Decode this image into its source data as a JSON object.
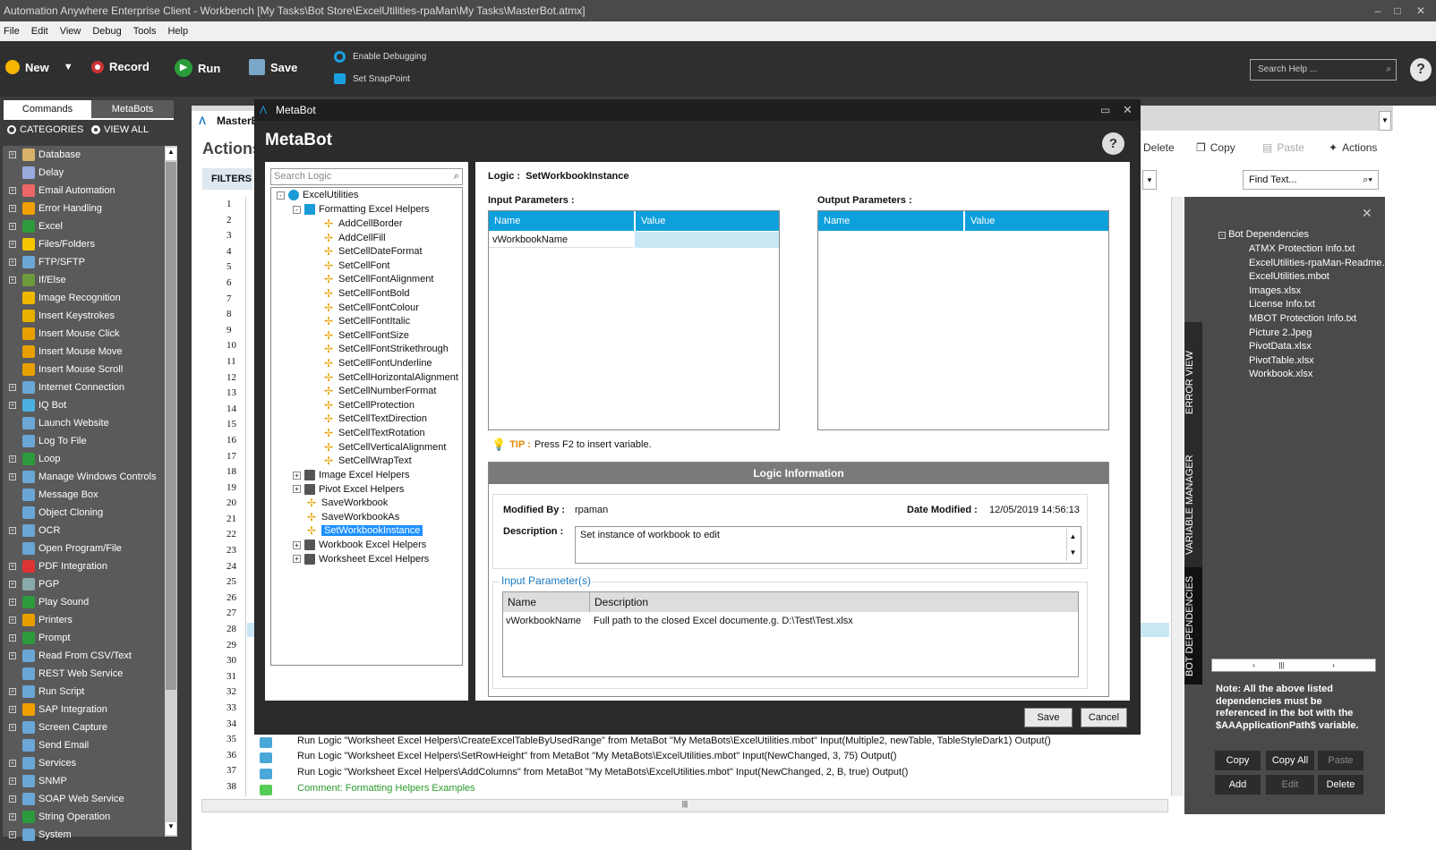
{
  "window": {
    "title": "Automation Anywhere Enterprise Client - Workbench [My Tasks\\Bot Store\\ExcelUtilities-rpaMan\\My Tasks\\MasterBot.atmx]"
  },
  "menu": [
    "File",
    "Edit",
    "View",
    "Debug",
    "Tools",
    "Help"
  ],
  "toolbar": {
    "new": "New",
    "record": "Record",
    "run": "Run",
    "save": "Save",
    "enable_debugging": "Enable Debugging",
    "set_snappoint": "Set SnapPoint",
    "search_help": "Search Help ..."
  },
  "left": {
    "tab_commands": "Commands",
    "tab_metabots": "MetaBots",
    "radio_categories": "CATEGORIES",
    "radio_viewall": "VIEW ALL",
    "commands": [
      "Database",
      "Delay",
      "Email Automation",
      "Error Handling",
      "Excel",
      "Files/Folders",
      "FTP/SFTP",
      "If/Else",
      "Image Recognition",
      "Insert Keystrokes",
      "Insert Mouse Click",
      "Insert Mouse Move",
      "Insert Mouse Scroll",
      "Internet Connection",
      "IQ Bot",
      "Launch Website",
      "Log To File",
      "Loop",
      "Manage Windows Controls",
      "Message Box",
      "Object Cloning",
      "OCR",
      "Open Program/File",
      "PDF Integration",
      "PGP",
      "Play Sound",
      "Printers",
      "Prompt",
      "Read From CSV/Text",
      "REST Web Service",
      "Run Script",
      "SAP Integration",
      "Screen Capture",
      "Send Email",
      "Services",
      "SNMP",
      "SOAP Web Service",
      "String Operation",
      "System"
    ]
  },
  "workbench": {
    "tab": "MasterBot",
    "actions_label": "Actions",
    "filters_label": "FILTERS",
    "tools": {
      "delete": "Delete",
      "copy": "Copy",
      "paste": "Paste",
      "actions": "Actions"
    },
    "find_text": "Find Text...",
    "line_numbers": [
      "1",
      "2",
      "3",
      "4",
      "5",
      "6",
      "7",
      "8",
      "9",
      "10",
      "11",
      "12",
      "13",
      "14",
      "15",
      "16",
      "17",
      "18",
      "19",
      "20",
      "21",
      "22",
      "23",
      "24",
      "25",
      "26",
      "27",
      "28",
      "29",
      "30",
      "31",
      "32",
      "33",
      "34",
      "35",
      "36",
      "37",
      "38"
    ],
    "visible_lines": [
      "Run Logic \"Worksheet Excel Helpers\\CreateExcelTableByUsedRange\" from MetaBot \"My MetaBots\\ExcelUtilities.mbot\" Input(Multiple2, newTable, TableStyleDark1) Output()",
      "Run Logic \"Worksheet Excel Helpers\\SetRowHeight\" from MetaBot \"My MetaBots\\ExcelUtilities.mbot\" Input(NewChanged, 3, 75) Output()",
      "Run Logic \"Worksheet Excel Helpers\\AddColumns\" from MetaBot \"My MetaBots\\ExcelUtilities.mbot\" Input(NewChanged, 2, B, true) Output()",
      "Comment: Formatting Helpers Examples"
    ]
  },
  "right": {
    "tabs": [
      "ERROR VIEW",
      "VARIABLE MANAGER",
      "BOT DEPENDENCIES"
    ],
    "root": "Bot Dependencies",
    "deps": [
      "ATMX Protection Info.txt",
      "ExcelUtilities-rpaMan-Readme.",
      "ExcelUtilities.mbot",
      "Images.xlsx",
      "License Info.txt",
      "MBOT Protection Info.txt",
      "Picture 2.Jpeg",
      "PivotData.xlsx",
      "PivotTable.xlsx",
      "Workbook.xlsx"
    ],
    "note": "Note: All the above listed dependencies must be referenced in the bot with the $AAApplicationPath$ variable.",
    "buttons": {
      "copy": "Copy",
      "copy_all": "Copy All",
      "paste": "Paste",
      "add": "Add",
      "edit": "Edit",
      "delete": "Delete"
    }
  },
  "dialog": {
    "title": "MetaBot",
    "heading": "MetaBot",
    "search_placeholder": "Search Logic",
    "tree_root": "ExcelUtilities",
    "folder_open": "Formatting Excel Helpers",
    "logics": [
      "AddCellBorder",
      "AddCellFill",
      "SetCellDateFormat",
      "SetCellFont",
      "SetCellFontAlignment",
      "SetCellFontBold",
      "SetCellFontColour",
      "SetCellFontItalic",
      "SetCellFontSize",
      "SetCellFontStrikethrough",
      "SetCellFontUnderline",
      "SetCellHorizontalAlignment",
      "SetCellNumberFormat",
      "SetCellProtection",
      "SetCellTextDirection",
      "SetCellTextRotation",
      "SetCellVerticalAlignment",
      "SetCellWrapText"
    ],
    "other_items": [
      {
        "label": "Image Excel Helpers",
        "kind": "folder"
      },
      {
        "label": "Pivot Excel Helpers",
        "kind": "folder"
      },
      {
        "label": "SaveWorkbook",
        "kind": "logic"
      },
      {
        "label": "SaveWorkbookAs",
        "kind": "logic"
      },
      {
        "label": "SetWorkbookInstance",
        "kind": "logic-selected"
      },
      {
        "label": "Workbook Excel Helpers",
        "kind": "folder"
      },
      {
        "label": "Worksheet Excel Helpers",
        "kind": "folder"
      }
    ],
    "logic_label": "Logic :",
    "logic_name": "SetWorkbookInstance",
    "input_params_label": "Input Parameters :",
    "output_params_label": "Output Parameters :",
    "col_name": "Name",
    "col_value": "Value",
    "input_row_name": "vWorkbookName",
    "tip_label": "TIP :",
    "tip_text": "Press F2 to insert variable.",
    "logic_info_header": "Logic Information",
    "modified_by_label": "Modified By :",
    "modified_by": "rpaman",
    "date_modified_label": "Date Modified :",
    "date_modified": "12/05/2019 14:56:13",
    "description_label": "Description :",
    "description": "Set instance of workbook to edit",
    "input_params_section": "Input Parameter(s)",
    "col_description": "Description",
    "param_name": "vWorkbookName",
    "param_desc": "Full path to the closed Excel documente.g. D:\\Test\\Test.xlsx",
    "save": "Save",
    "cancel": "Cancel"
  },
  "colors": {
    "accent": "#0ea0dc",
    "selected": "#1e90ff",
    "dark": "#2b2b2b",
    "toolbar": "#2f2f2f"
  }
}
